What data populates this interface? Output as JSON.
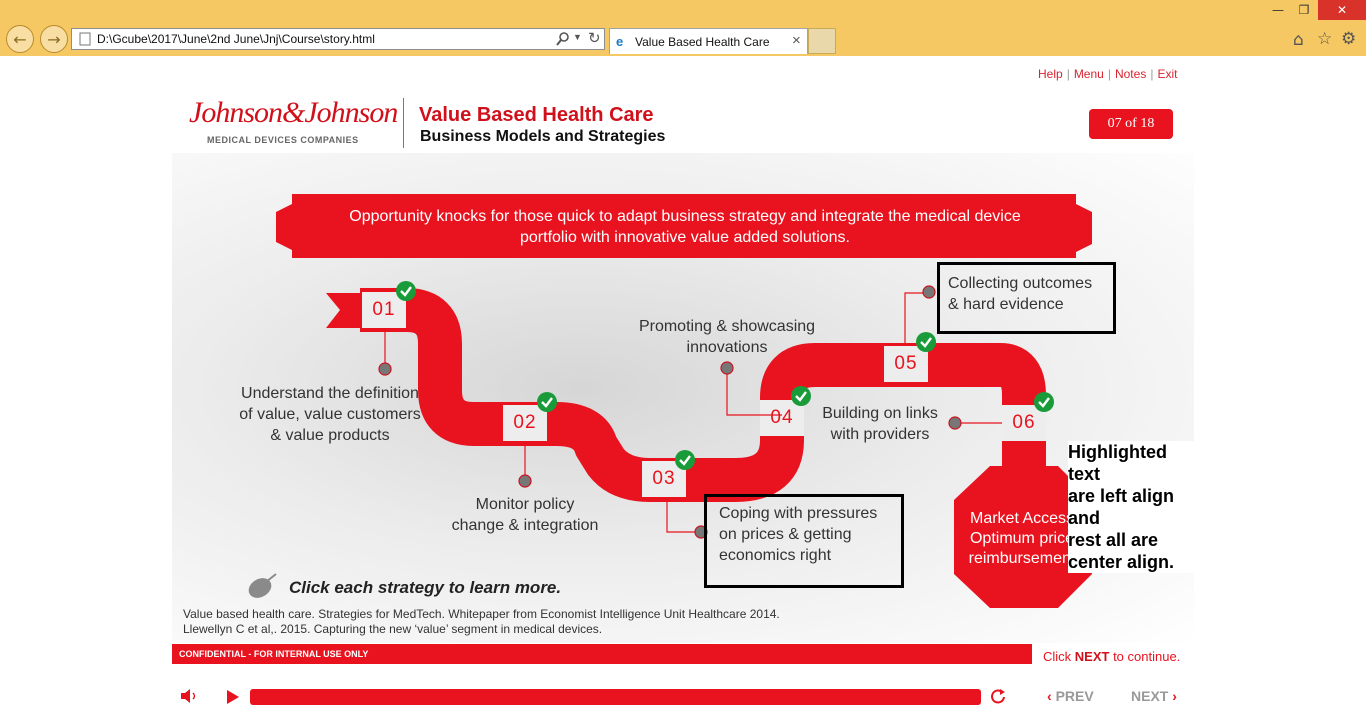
{
  "browser": {
    "address": "D:\\Gcube\\2017\\June\\2nd June\\Jnj\\Course\\story.html",
    "tab_title": "Value Based Health Care",
    "tab_close": "×"
  },
  "toplinks": {
    "help": "Help",
    "menu": "Menu",
    "notes": "Notes",
    "exit": "Exit",
    "separator": "|"
  },
  "header": {
    "logo": "Johnson&Johnson",
    "logo_sub": "MEDICAL DEVICES COMPANIES",
    "title": "Value Based Health Care",
    "subtitle": "Business Models and Strategies",
    "page_counter": "07 of 18"
  },
  "banner": {
    "line1": "Opportunity knocks for those quick to adapt business strategy and integrate the medical device",
    "line2": "portfolio with innovative value added solutions."
  },
  "steps": [
    {
      "num": "01",
      "l1": "Understand the definition",
      "l2": "of value, value customers",
      "l3": "& value products"
    },
    {
      "num": "02",
      "l1": "Monitor policy",
      "l2": "change & integration"
    },
    {
      "num": "03",
      "l1": "Coping with pressures",
      "l2": "on prices & getting",
      "l3": "economics right"
    },
    {
      "num": "04",
      "l1": "Promoting & showcasing",
      "l2": "innovations"
    },
    {
      "num": "05",
      "l1": "Collecting outcomes",
      "l2": "& hard evidence"
    },
    {
      "num": "06",
      "l1": "Building on links",
      "l2": "with providers"
    }
  ],
  "outcome": {
    "l1": "Market Access",
    "l2": "Optimum price",
    "l3": "reimbursement"
  },
  "annotation": {
    "l1": "Highlighted text",
    "l2": "are left align and",
    "l3": "rest all are",
    "l4": "center align."
  },
  "hint": "Click each strategy to learn more.",
  "references": {
    "r1": "Value based health care. Strategies for MedTech. Whitepaper from Economist Intelligence Unit Healthcare 2014.",
    "r2": "Llewellyn C et al,. 2015. Capturing the new ‘value’ segment in medical devices."
  },
  "footer": {
    "confidential": "CONFIDENTIAL - FOR INTERNAL USE ONLY",
    "click_pre": "Click ",
    "click_next": "NEXT",
    "click_post": " to continue."
  },
  "player": {
    "prev": "PREV",
    "next": "NEXT",
    "progress": 1.0
  },
  "colors": {
    "brand_red": "#e8131f",
    "chrome": "#f5c863",
    "check_green": "#1a9b3a"
  }
}
